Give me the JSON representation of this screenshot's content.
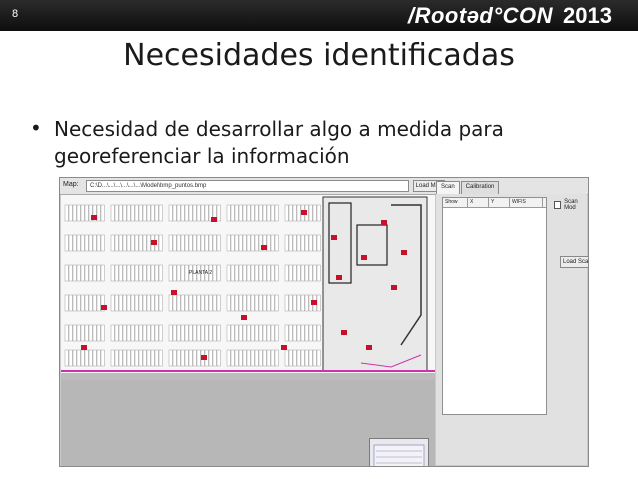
{
  "header": {
    "slide_number": "8",
    "brand_name": "/Rootəd°CON",
    "brand_year": "2013"
  },
  "slide": {
    "title": "Necesidades identificadas",
    "bullets": [
      "Necesidad de desarrollar algo a medida para georeferenciar la información"
    ]
  },
  "app": {
    "map_label": "Map:",
    "map_path": "C:\\D...\\...\\...\\...\\...\\...\\Model\\bmp_puntos.bmp",
    "load_map_button": "Load Map",
    "tabs": [
      "Scan",
      "Calibration"
    ],
    "active_tab": "Scan",
    "grid_columns": [
      "Show",
      "X",
      "Y",
      "WIFIS"
    ],
    "scan_mode_label": "Scan Mod",
    "load_scan_button": "Load Sca",
    "floor_label": "PLANTA 2",
    "colors": {
      "accent_red": "#c8102e",
      "pink_route": "#cc33aa",
      "plan_gray": "#b7b7b7"
    }
  }
}
